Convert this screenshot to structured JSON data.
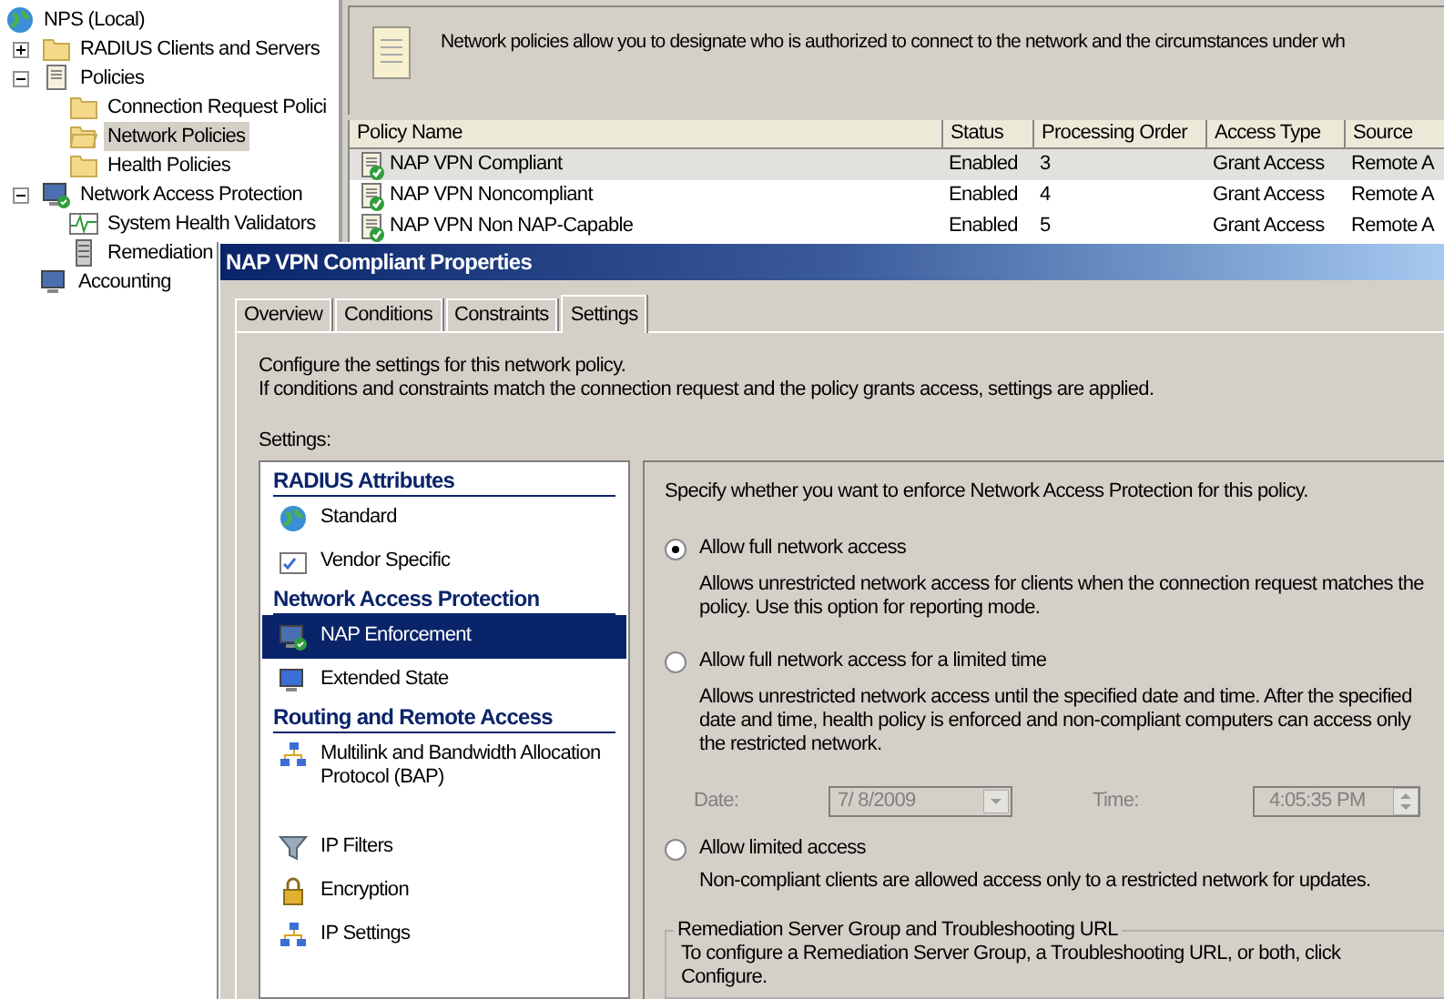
{
  "tree": [
    {
      "label": "NPS (Local)",
      "selected": false,
      "children": [
        {
          "label": "RADIUS Clients and Servers",
          "selected": false,
          "expanded": false
        },
        {
          "label": "Policies",
          "selected": false,
          "expanded": true,
          "children": [
            {
              "label": "Connection Request Polici",
              "selected": false
            },
            {
              "label": "Network Policies",
              "selected": true
            },
            {
              "label": "Health Policies",
              "selected": false
            }
          ]
        },
        {
          "label": "Network Access Protection",
          "selected": false,
          "expanded": true,
          "children": [
            {
              "label": "System Health Validators",
              "selected": false
            },
            {
              "label": "Remediation",
              "selected": false
            }
          ]
        },
        {
          "label": "Accounting",
          "selected": false
        }
      ]
    }
  ],
  "header": {
    "text": "Network policies allow you to designate who is authorized to connect to the network and the circumstances under wh"
  },
  "table": {
    "columns": [
      "Policy Name",
      "Status",
      "Processing Order",
      "Access Type",
      "Source"
    ],
    "rows": [
      {
        "cells": [
          "NAP VPN Compliant",
          "Enabled",
          "3",
          "Grant Access",
          "Remote A"
        ],
        "selected": true
      },
      {
        "cells": [
          "NAP VPN Noncompliant",
          "Enabled",
          "4",
          "Grant Access",
          "Remote A"
        ],
        "selected": false
      },
      {
        "cells": [
          "NAP VPN Non NAP-Capable",
          "Enabled",
          "5",
          "Grant Access",
          "Remote A"
        ],
        "selected": false
      }
    ]
  },
  "dialog": {
    "title": "NAP VPN Compliant Properties",
    "tabs": [
      {
        "label": "Overview",
        "selected": false
      },
      {
        "label": "Conditions",
        "selected": false
      },
      {
        "label": "Constraints",
        "selected": false
      },
      {
        "label": "Settings",
        "selected": true
      }
    ],
    "intro": [
      "Configure the settings for this network policy.",
      "If conditions and constraints match the connection request and the policy grants access, settings are applied."
    ],
    "settings_label": "Settings:",
    "settings": [
      {
        "kind": "heading",
        "label": "RADIUS Attributes"
      },
      {
        "kind": "item",
        "label": "Standard",
        "selected": false
      },
      {
        "kind": "item",
        "label": "Vendor Specific",
        "selected": false
      },
      {
        "kind": "heading",
        "label": "Network Access Protection"
      },
      {
        "kind": "item",
        "label": "NAP Enforcement",
        "selected": true
      },
      {
        "kind": "item",
        "label": "Extended State",
        "selected": false
      },
      {
        "kind": "heading",
        "label": "Routing and Remote Access"
      },
      {
        "kind": "item",
        "label": "Multilink and Bandwidth Allocation Protocol (BAP)",
        "selected": false
      },
      {
        "kind": "item",
        "label": "IP Filters",
        "selected": false
      },
      {
        "kind": "item",
        "label": "Encryption",
        "selected": false
      },
      {
        "kind": "item",
        "label": "IP Settings",
        "selected": false
      }
    ],
    "prompt": "Specify whether you want to enforce Network Access Protection for this policy.",
    "options": [
      {
        "label": "Allow full network access",
        "selected": true,
        "description": "Allows unrestricted network access for clients when the connection request matches the policy.  Use this option for reporting mode."
      },
      {
        "label": "Allow full network access for a limited time",
        "selected": false,
        "description": "Allows unrestricted network access until the specified date and time. After the specified date and time, health policy is enforced and non-compliant computers can access only the restricted network.",
        "date": {
          "label": "Date:",
          "value": "7/ 8/2009",
          "disabled": true
        },
        "time": {
          "label": "Time:",
          "value": "4:05:35 PM",
          "disabled": true
        }
      },
      {
        "label": "Allow limited access",
        "selected": false,
        "description": "Non-compliant clients are allowed access only to a restricted network for updates."
      }
    ],
    "group": {
      "title": "Remediation Server Group and Troubleshooting URL",
      "text": "To configure a Remediation Server Group, a Troubleshooting URL, or both, click Configure."
    }
  }
}
